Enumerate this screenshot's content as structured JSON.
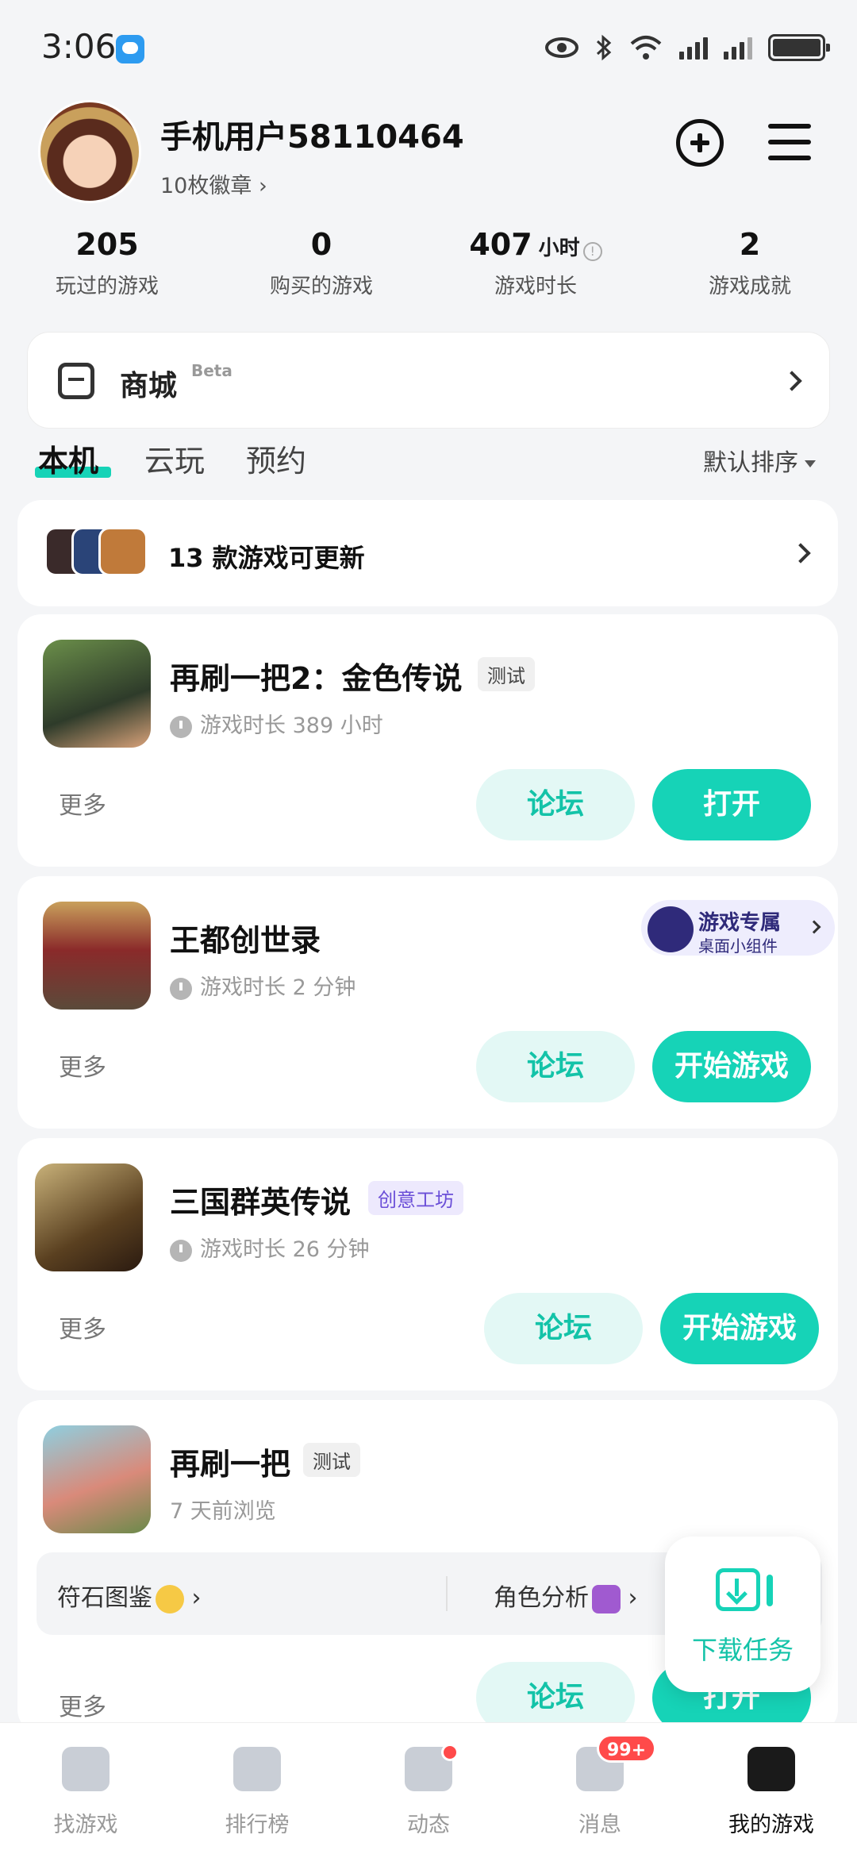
{
  "status_bar": {
    "time": "3:06",
    "icons": [
      "chat-app-icon",
      "eye-icon",
      "bluetooth-icon",
      "wifi-icon",
      "signal-icon",
      "signal-icon",
      "battery-icon"
    ]
  },
  "profile": {
    "username": "手机用户58110464",
    "badges_label": "10枚徽章 ›"
  },
  "stats": [
    {
      "value": "205",
      "unit": "",
      "label": "玩过的游戏"
    },
    {
      "value": "0",
      "unit": "",
      "label": "购买的游戏"
    },
    {
      "value": "407",
      "unit": "小时",
      "label": "游戏时长"
    },
    {
      "value": "2",
      "unit": "",
      "label": "游戏成就"
    }
  ],
  "mall": {
    "label": "商城",
    "badge": "Beta"
  },
  "tabs": [
    {
      "label": "本机",
      "active": true
    },
    {
      "label": "云玩",
      "active": false
    },
    {
      "label": "预约",
      "active": false
    }
  ],
  "sort_label": "默认排序",
  "update_banner": {
    "text": "13 款游戏可更新"
  },
  "games": [
    {
      "title": "再刷一把2：金色传说",
      "tag": "测试",
      "playtime": "游戏时长 389 小时",
      "more": "更多",
      "forum": "论坛",
      "action": "打开"
    },
    {
      "title": "王都创世录",
      "playtime": "游戏时长 2 分钟",
      "widget_title": "游戏专属",
      "widget_sub": "桌面小组件",
      "more": "更多",
      "forum": "论坛",
      "action": "开始游戏"
    },
    {
      "title": "三国群英传说",
      "tag": "创意工坊",
      "playtime": "游戏时长 26 分钟",
      "more": "更多",
      "forum": "论坛",
      "action": "开始游戏"
    },
    {
      "title": "再刷一把",
      "tag": "测试",
      "playtime": "7 天前浏览",
      "tool1": "符石图鉴",
      "tool2": "角色分析",
      "more": "更多",
      "forum": "论坛",
      "action": "打开"
    }
  ],
  "download_fab": {
    "label": "下载任务"
  },
  "bottom_nav": [
    {
      "label": "找游戏",
      "icon": "find-game-icon"
    },
    {
      "label": "排行榜",
      "icon": "ranking-icon"
    },
    {
      "label": "动态",
      "icon": "feed-icon"
    },
    {
      "label": "消息",
      "icon": "message-icon",
      "badge": "99+"
    },
    {
      "label": "我的游戏",
      "icon": "my-games-icon",
      "active": true
    }
  ],
  "colors": {
    "accent": "#16d3b7",
    "accent_light": "#e3f8f5",
    "background": "#f4f5f7",
    "badge_red": "#ff4a4a"
  }
}
